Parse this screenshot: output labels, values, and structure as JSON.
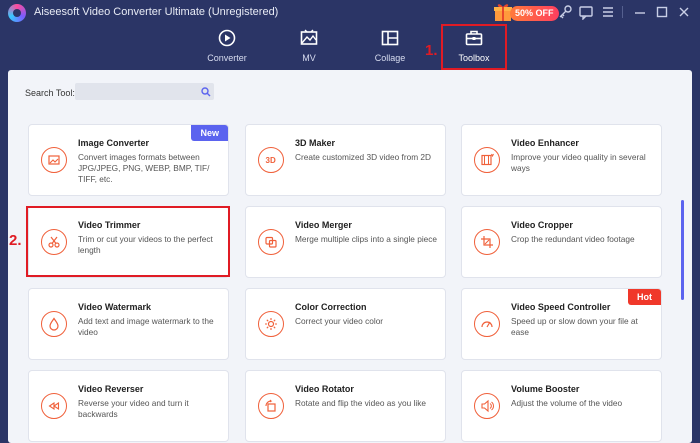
{
  "window": {
    "title": "Aiseesoft Video Converter Ultimate (Unregistered)",
    "promo_badge": "50% OFF"
  },
  "nav": {
    "tabs": [
      {
        "label": "Converter",
        "icon": "converter-icon"
      },
      {
        "label": "MV",
        "icon": "mv-icon"
      },
      {
        "label": "Collage",
        "icon": "collage-icon"
      },
      {
        "label": "Toolbox",
        "icon": "toolbox-icon",
        "active": true
      }
    ]
  },
  "annotations": {
    "step1": "1.",
    "step2": "2."
  },
  "search": {
    "label": "Search Tool:",
    "value": "",
    "placeholder": ""
  },
  "tools": [
    {
      "title": "Image Converter",
      "desc": "Convert images formats between JPG/JPEG, PNG, WEBP, BMP, TIF/ TIFF, etc.",
      "badge": "New",
      "icon": "image-converter-icon"
    },
    {
      "title": "3D Maker",
      "desc": "Create customized 3D video from 2D",
      "icon": "3d-icon"
    },
    {
      "title": "Video Enhancer",
      "desc": "Improve your video quality in several ways",
      "icon": "enhancer-icon"
    },
    {
      "title": "Video Trimmer",
      "desc": "Trim or cut your videos to the perfect length",
      "icon": "scissors-icon"
    },
    {
      "title": "Video Merger",
      "desc": "Merge multiple clips into a single piece",
      "icon": "merge-icon"
    },
    {
      "title": "Video Cropper",
      "desc": "Crop the redundant video footage",
      "icon": "crop-icon"
    },
    {
      "title": "Video Watermark",
      "desc": "Add text and image watermark to the video",
      "icon": "drop-icon"
    },
    {
      "title": "Color Correction",
      "desc": "Correct your video color",
      "icon": "sun-icon"
    },
    {
      "title": "Video Speed Controller",
      "desc": "Speed up or slow down your file at ease",
      "badge": "Hot",
      "icon": "speedometer-icon"
    },
    {
      "title": "Video Reverser",
      "desc": "Reverse your video and turn it backwards",
      "icon": "rewind-icon"
    },
    {
      "title": "Video Rotator",
      "desc": "Rotate and flip the video as you like",
      "icon": "rotate-icon"
    },
    {
      "title": "Volume Booster",
      "desc": "Adjust the volume of the video",
      "icon": "volume-icon"
    }
  ],
  "colors": {
    "titlebar_bg": "#2b3566",
    "accent_orange": "#f0603a",
    "badge_new": "#5b63ef",
    "badge_hot": "#f0382a",
    "annotation_red": "#e01b24"
  }
}
